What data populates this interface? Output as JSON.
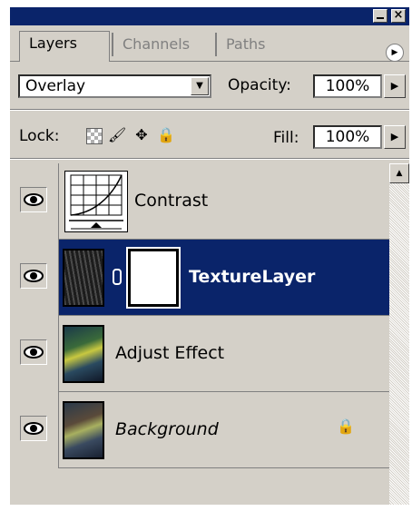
{
  "tabs": [
    "Layers",
    "Channels",
    "Paths"
  ],
  "blend_mode": "Overlay",
  "opacity_label": "Opacity:",
  "opacity_value": "100%",
  "lock_label": "Lock:",
  "fill_label": "Fill:",
  "fill_value": "100%",
  "layers": [
    {
      "name": "Contrast",
      "visible_icon": "eye-icon",
      "thumb": "curves-adjustment-icon"
    },
    {
      "name": "TextureLayer",
      "visible_icon": "eye-icon",
      "thumb": "texture-thumbnail",
      "mask": "white-mask",
      "selected": true
    },
    {
      "name": "Adjust Effect",
      "visible_icon": "eye-icon",
      "thumb": "photo-thumbnail"
    },
    {
      "name": "Background",
      "visible_icon": "eye-icon",
      "thumb": "photo-thumbnail",
      "locked": true
    }
  ],
  "colors": {
    "selection": "#0a246a",
    "panel": "#d4d0c8",
    "titlebar": "#0a246a"
  }
}
